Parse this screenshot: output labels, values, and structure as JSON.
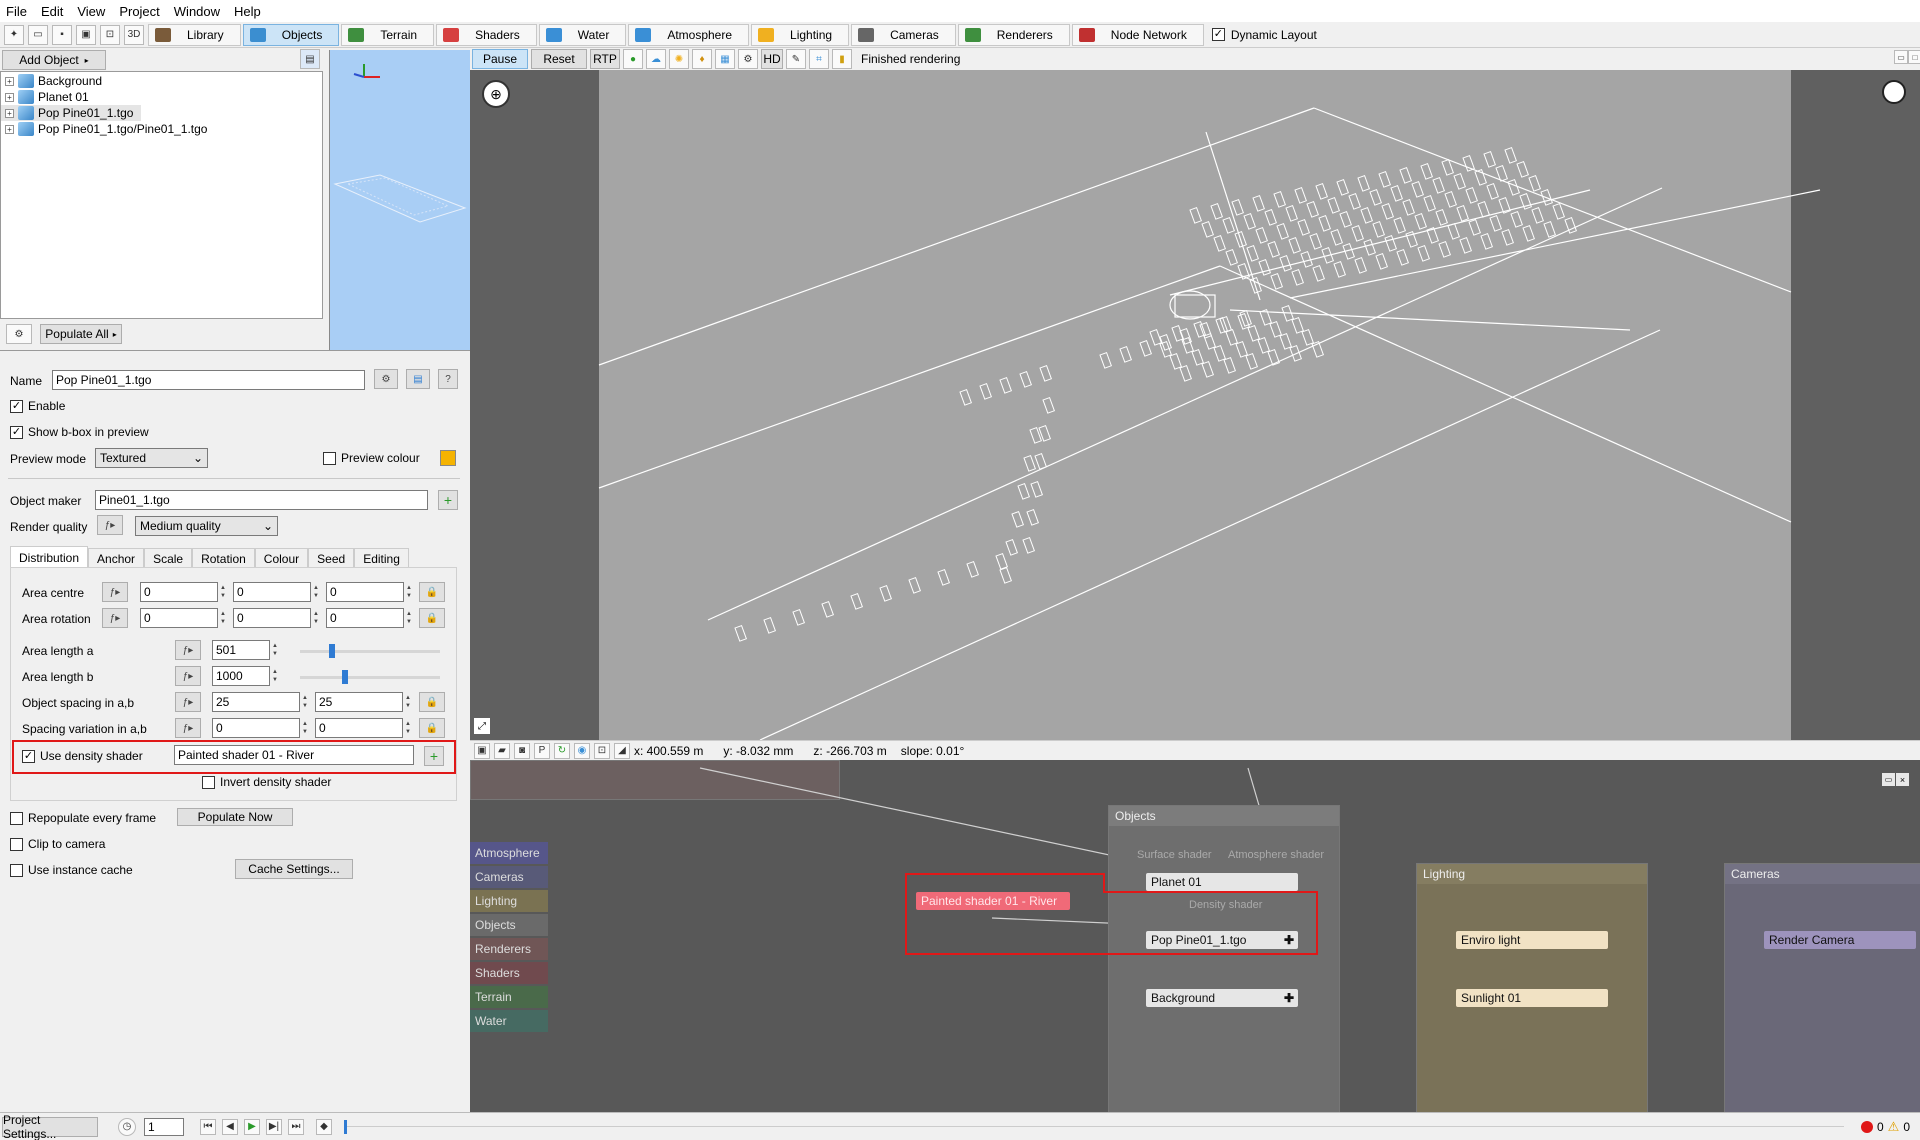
{
  "menu": [
    "File",
    "Edit",
    "View",
    "Project",
    "Window",
    "Help"
  ],
  "toolbar": {
    "tabs": [
      {
        "label": "Library",
        "icon": "library-icon",
        "color": "#7a5b3a"
      },
      {
        "label": "Objects",
        "icon": "cube-icon",
        "color": "#3b8ed0",
        "active": true
      },
      {
        "label": "Terrain",
        "icon": "terrain-icon",
        "color": "#3f8f3f"
      },
      {
        "label": "Shaders",
        "icon": "sphere-icon",
        "color": "#d64040"
      },
      {
        "label": "Water",
        "icon": "water-drop-icon",
        "color": "#3a8fd6"
      },
      {
        "label": "Atmosphere",
        "icon": "cloud-icon",
        "color": "#3a8fd6"
      },
      {
        "label": "Lighting",
        "icon": "sun-icon",
        "color": "#f0b020"
      },
      {
        "label": "Cameras",
        "icon": "camera-icon",
        "color": "#666666"
      },
      {
        "label": "Renderers",
        "icon": "landscape-icon",
        "color": "#3f8f3f"
      },
      {
        "label": "Node Network",
        "icon": "node-network-icon",
        "color": "#c03030"
      }
    ],
    "dynamic_layout": "Dynamic Layout"
  },
  "left_panel": {
    "add_object": "Add Object",
    "tree": [
      "Background",
      "Planet 01",
      "Pop Pine01_1.tgo",
      "Pop Pine01_1.tgo/Pine01_1.tgo"
    ],
    "populate_all": "Populate All"
  },
  "props": {
    "name_label": "Name",
    "name_value": "Pop Pine01_1.tgo",
    "enable": "Enable",
    "show_bbox": "Show b-box in preview",
    "preview_mode_label": "Preview mode",
    "preview_mode_value": "Textured",
    "preview_colour": "Preview colour",
    "object_maker_label": "Object maker",
    "object_maker_value": "Pine01_1.tgo",
    "render_quality_label": "Render quality",
    "render_quality_value": "Medium quality",
    "tabs": [
      "Distribution",
      "Anchor",
      "Scale",
      "Rotation",
      "Colour",
      "Seed",
      "Editing"
    ],
    "area_centre_label": "Area centre",
    "area_centre": [
      "0",
      "0",
      "0"
    ],
    "area_rotation_label": "Area rotation",
    "area_rotation": [
      "0",
      "0",
      "0"
    ],
    "area_length_a_label": "Area length a",
    "area_length_a": "501",
    "area_length_b_label": "Area length b",
    "area_length_b": "1000",
    "object_spacing_label": "Object spacing in a,b",
    "object_spacing": [
      "25",
      "25"
    ],
    "spacing_variation_label": "Spacing variation in a,b",
    "spacing_variation": [
      "0",
      "0"
    ],
    "use_density_shader": "Use density shader",
    "density_shader_value": "Painted shader 01 - River",
    "invert_density_shader": "Invert density shader",
    "repopulate": "Repopulate every frame",
    "populate_now": "Populate Now",
    "clip_to_camera": "Clip to camera",
    "use_instance_cache": "Use instance cache",
    "cache_settings": "Cache Settings..."
  },
  "viewport": {
    "pause": "Pause",
    "reset": "Reset",
    "rtp": "RTP",
    "hd": "HD",
    "status": "Finished rendering",
    "coords": {
      "x": "x: 400.559 m",
      "y": "y: -8.032 mm",
      "z": "z: -266.703 m",
      "slope": "slope: 0.01°"
    }
  },
  "nodes": {
    "sidebar": [
      {
        "label": "Atmosphere",
        "color": "#56568a"
      },
      {
        "label": "Cameras",
        "color": "#585a78"
      },
      {
        "label": "Lighting",
        "color": "#7a7252"
      },
      {
        "label": "Objects",
        "color": "#6a6a6a"
      },
      {
        "label": "Renderers",
        "color": "#705656"
      },
      {
        "label": "Shaders",
        "color": "#704a4e"
      },
      {
        "label": "Terrain",
        "color": "#4a6a4a"
      },
      {
        "label": "Water",
        "color": "#466a62"
      }
    ],
    "objects_group": "Objects",
    "surface_shader": "Surface shader",
    "atmosphere_shader": "Atmosphere shader",
    "density_shader": "Density shader",
    "planet": "Planet 01",
    "painted_shader": "Painted shader 01 - River",
    "pop_pine": "Pop Pine01_1.tgo",
    "background": "Background",
    "lighting_group": "Lighting",
    "enviro_light": "Enviro light",
    "sunlight": "Sunlight 01",
    "cameras_group": "Cameras",
    "render_camera": "Render Camera"
  },
  "bottom": {
    "project_settings": "Project Settings...",
    "frame": "1",
    "errors": "0",
    "warnings": "0"
  }
}
